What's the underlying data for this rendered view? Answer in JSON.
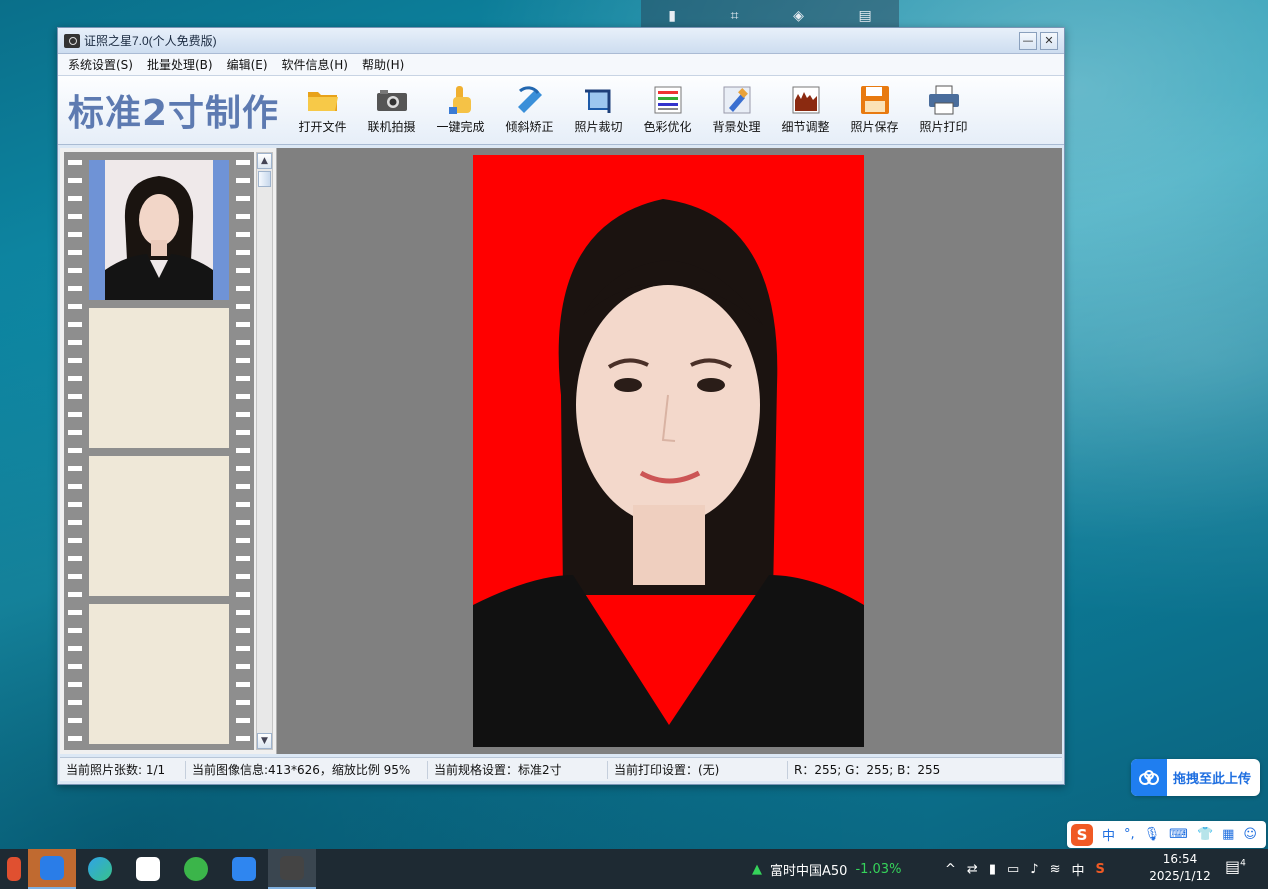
{
  "window": {
    "title": "证照之星7.0(个人免费版)",
    "minimize": "—",
    "close": "✕"
  },
  "menu": [
    "系统设置(S)",
    "批量处理(B)",
    "编辑(E)",
    "软件信息(H)",
    "帮助(H)"
  ],
  "toolbar": {
    "brand": "标准2寸制作",
    "tools": [
      {
        "label": "打开文件",
        "icon": "folder-icon"
      },
      {
        "label": "联机拍摄",
        "icon": "camera-icon"
      },
      {
        "label": "一键完成",
        "icon": "hand-pointer-icon"
      },
      {
        "label": "倾斜矫正",
        "icon": "rotate-icon"
      },
      {
        "label": "照片裁切",
        "icon": "crop-icon"
      },
      {
        "label": "色彩优化",
        "icon": "color-palette-icon"
      },
      {
        "label": "背景处理",
        "icon": "brush-icon"
      },
      {
        "label": "细节调整",
        "icon": "histogram-icon"
      },
      {
        "label": "照片保存",
        "icon": "floppy-save-icon"
      },
      {
        "label": "照片打印",
        "icon": "printer-icon"
      }
    ]
  },
  "status": {
    "count": "当前照片张数: 1/1",
    "image_info": "当前图像信息:413*626，缩放比例 95%",
    "spec": "当前规格设置：标准2寸",
    "print": "当前打印设置：(无)",
    "rgb": "R：255; G：255; B：255"
  },
  "colors": {
    "photo_background": "#ff0000",
    "brand_text": "#5d7ab1",
    "selected_frame": "#6f93d6",
    "stock_up": "#35d35a"
  },
  "upload": {
    "label": "拖拽至此上传"
  },
  "ime": {
    "lang": "中",
    "punct": "°,"
  },
  "taskbar": {
    "stock_name": "富时中国A50",
    "stock_change": "-1.03%",
    "tray_lang": "中",
    "time": "16:54",
    "date": "2025/1/12",
    "notifications": "4"
  }
}
